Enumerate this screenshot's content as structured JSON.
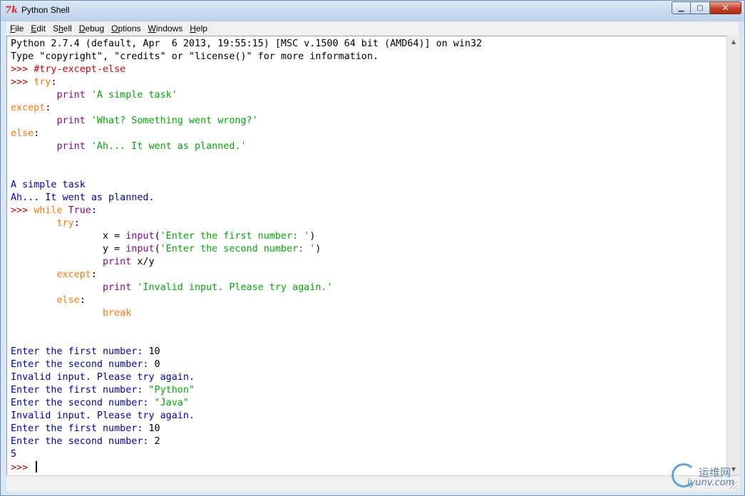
{
  "window": {
    "title": "Python Shell"
  },
  "window_controls": {
    "minimize": "▁",
    "maximize": "▢",
    "close": "✕"
  },
  "menu": [
    {
      "underline": "F",
      "rest": "ile"
    },
    {
      "underline": "E",
      "rest": "dit"
    },
    {
      "underline": "S",
      "rest": "hell",
      "pre": "Sh",
      "pre_plain": true
    },
    {
      "underline": "D",
      "rest": "ebug"
    },
    {
      "underline": "O",
      "rest": "ptions"
    },
    {
      "underline": "W",
      "rest": "indows"
    },
    {
      "underline": "H",
      "rest": "elp"
    }
  ],
  "shell": {
    "lines": [
      [
        [
          "t",
          "Python 2.7.4 (default, Apr  6 2013, 19:55:15) [MSC v.1500 64 bit (AMD64)] on win32"
        ]
      ],
      [
        [
          "t",
          "Type \"copyright\", \"credits\" or \"license()\" for more information."
        ]
      ],
      [
        [
          "p",
          ">>> "
        ],
        [
          "c",
          "#try-except-else"
        ]
      ],
      [
        [
          "p",
          ">>> "
        ],
        [
          "k",
          "try"
        ],
        [
          "t",
          ":"
        ]
      ],
      [
        [
          "t",
          "        "
        ],
        [
          "b",
          "print"
        ],
        [
          "t",
          " "
        ],
        [
          "s",
          "'A simple task'"
        ]
      ],
      [
        [
          "k",
          "except"
        ],
        [
          "t",
          ":"
        ]
      ],
      [
        [
          "t",
          "        "
        ],
        [
          "b",
          "print"
        ],
        [
          "t",
          " "
        ],
        [
          "s",
          "'What? Something went wrong?'"
        ]
      ],
      [
        [
          "k",
          "else"
        ],
        [
          "t",
          ":"
        ]
      ],
      [
        [
          "t",
          "        "
        ],
        [
          "b",
          "print"
        ],
        [
          "t",
          " "
        ],
        [
          "s",
          "'Ah... It went as planned.'"
        ]
      ],
      [],
      [],
      [
        [
          "o",
          "A simple task"
        ]
      ],
      [
        [
          "o",
          "Ah... It went as planned."
        ]
      ],
      [
        [
          "p",
          ">>> "
        ],
        [
          "k",
          "while"
        ],
        [
          "t",
          " "
        ],
        [
          "b",
          "True"
        ],
        [
          "t",
          ":"
        ]
      ],
      [
        [
          "t",
          "        "
        ],
        [
          "k",
          "try"
        ],
        [
          "t",
          ":"
        ]
      ],
      [
        [
          "t",
          "                x = "
        ],
        [
          "b",
          "input"
        ],
        [
          "t",
          "("
        ],
        [
          "s",
          "'Enter the first number: '"
        ],
        [
          "t",
          ")"
        ]
      ],
      [
        [
          "t",
          "                y = "
        ],
        [
          "b",
          "input"
        ],
        [
          "t",
          "("
        ],
        [
          "s",
          "'Enter the second number: '"
        ],
        [
          "t",
          ")"
        ]
      ],
      [
        [
          "t",
          "                "
        ],
        [
          "b",
          "print"
        ],
        [
          "t",
          " x/y"
        ]
      ],
      [
        [
          "t",
          "        "
        ],
        [
          "k",
          "except"
        ],
        [
          "t",
          ":"
        ]
      ],
      [
        [
          "t",
          "                "
        ],
        [
          "b",
          "print"
        ],
        [
          "t",
          " "
        ],
        [
          "s",
          "'Invalid input. Please try again.'"
        ]
      ],
      [
        [
          "t",
          "        "
        ],
        [
          "k",
          "else"
        ],
        [
          "t",
          ":"
        ]
      ],
      [
        [
          "t",
          "                "
        ],
        [
          "k",
          "break"
        ]
      ],
      [],
      [],
      [
        [
          "o",
          "Enter the first number: "
        ],
        [
          "t",
          "10"
        ]
      ],
      [
        [
          "o",
          "Enter the second number: "
        ],
        [
          "t",
          "0"
        ]
      ],
      [
        [
          "o",
          "Invalid input. Please try again."
        ]
      ],
      [
        [
          "o",
          "Enter the first number: "
        ],
        [
          "s",
          "\"Python\""
        ]
      ],
      [
        [
          "o",
          "Enter the second number: "
        ],
        [
          "s",
          "\"Java\""
        ]
      ],
      [
        [
          "o",
          "Invalid input. Please try again."
        ]
      ],
      [
        [
          "o",
          "Enter the first number: "
        ],
        [
          "t",
          "10"
        ]
      ],
      [
        [
          "o",
          "Enter the second number: "
        ],
        [
          "t",
          "2"
        ]
      ],
      [
        [
          "o",
          "5"
        ]
      ],
      [
        [
          "p",
          ">>> "
        ]
      ]
    ]
  },
  "watermark": {
    "cn": "运维网",
    "en": "iyunv.com"
  }
}
